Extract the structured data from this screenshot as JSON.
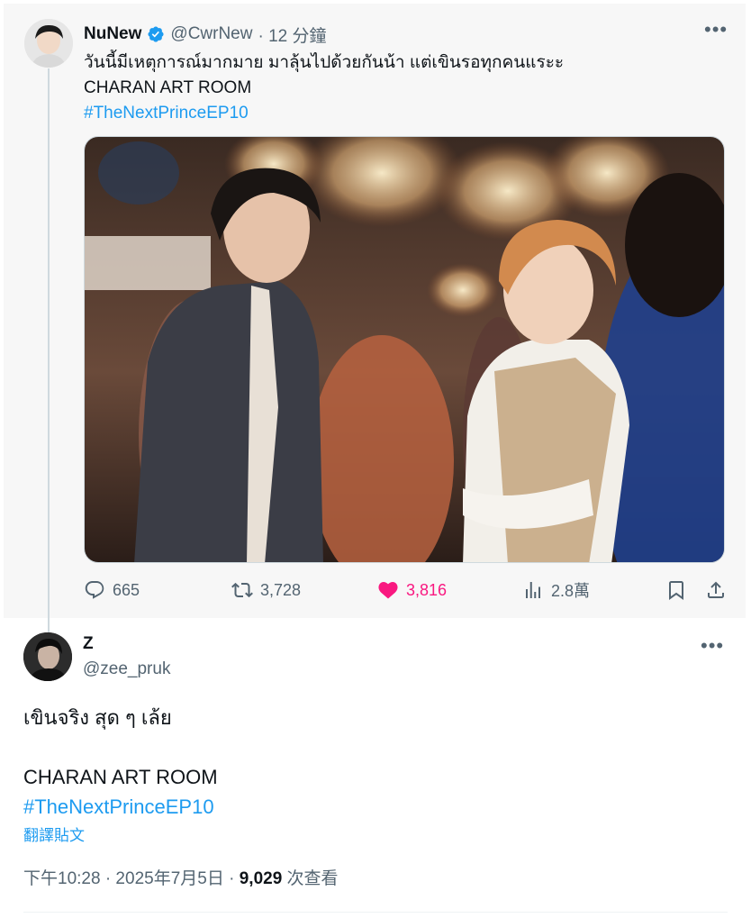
{
  "parent_tweet": {
    "display_name": "NuNew",
    "handle": "@CwrNew",
    "time": "· 12 分鐘",
    "text_lines": [
      "วันนี้มีเหตุการณ์มากมาย มาลุ้นไปด้วยกันน้า แต่เขินรอทุกคนแระะ",
      "CHARAN ART ROOM"
    ],
    "hashtag": "#TheNextPrinceEP10",
    "stats": {
      "replies": "665",
      "retweets": "3,728",
      "likes": "3,816",
      "views": "2.8萬"
    }
  },
  "reply_tweet": {
    "display_name": "Z",
    "handle": "@zee_pruk",
    "text_lines": [
      "เขินจริง สุด ๆ เล้ย",
      "",
      "CHARAN ART ROOM"
    ],
    "hashtag": "#TheNextPrinceEP10",
    "translate_label": "翻譯貼文",
    "timestamp": "下午10:28 · 2025年7月5日 · ",
    "view_count": "9,029",
    "view_label": " 次查看"
  },
  "colors": {
    "accent": "#1d9bf0",
    "like": "#f91880",
    "secondary_text": "#536471",
    "primary_text": "#0f1419"
  },
  "icons": [
    "verified-badge-icon",
    "more-icon",
    "reply-icon",
    "retweet-icon",
    "heart-icon",
    "views-icon",
    "bookmark-icon",
    "share-icon"
  ]
}
